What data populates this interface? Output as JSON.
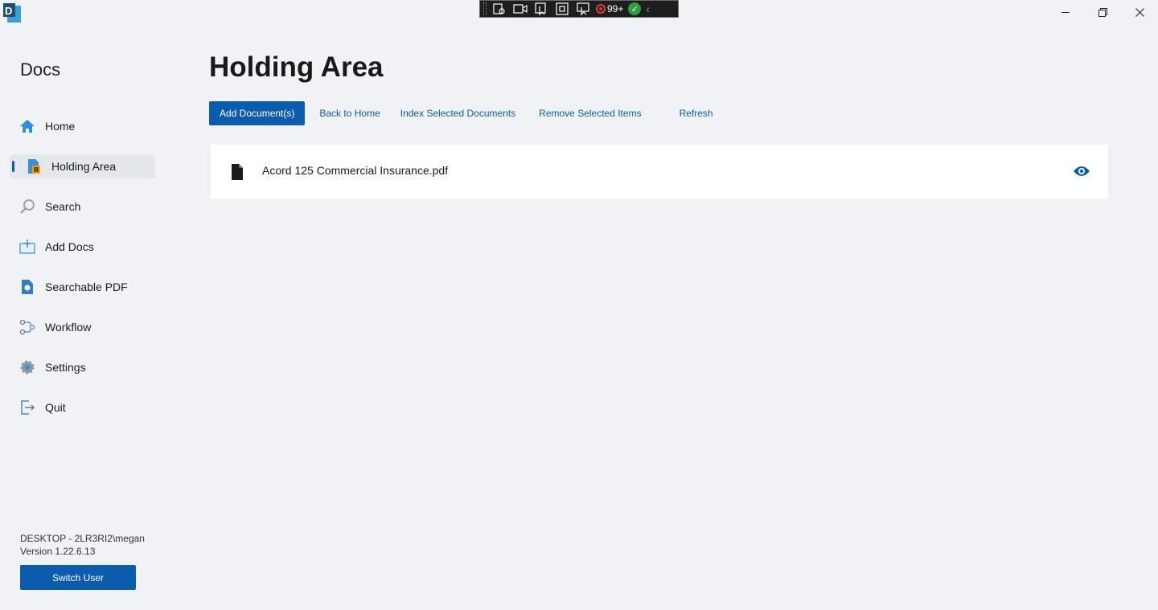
{
  "app": {
    "icon_name": "docs-app-icon",
    "window_controls": [
      "minimize",
      "restore",
      "close"
    ]
  },
  "recorder_toolbar": {
    "count": "99+",
    "icons": [
      "grip-icon",
      "screen-settings-icon",
      "camera-icon",
      "pointer-icon",
      "region-icon",
      "capture-icon",
      "record-icon",
      "check-icon",
      "chevron-left-icon"
    ]
  },
  "sidebar": {
    "title": "Docs",
    "items": [
      {
        "label": "Home",
        "icon": "home-icon",
        "active": false
      },
      {
        "label": "Holding Area",
        "icon": "holding-area-icon",
        "active": true
      },
      {
        "label": "Search",
        "icon": "search-icon",
        "active": false
      },
      {
        "label": "Add Docs",
        "icon": "add-docs-icon",
        "active": false
      },
      {
        "label": "Searchable PDF",
        "icon": "searchable-pdf-icon",
        "active": false
      },
      {
        "label": "Workflow",
        "icon": "workflow-icon",
        "active": false
      },
      {
        "label": "Settings",
        "icon": "gear-icon",
        "active": false
      },
      {
        "label": "Quit",
        "icon": "quit-icon",
        "active": false
      }
    ],
    "user": "DESKTOP - 2LR3RI2\\megan",
    "version": "Version 1.22.6.13",
    "switch_user_label": "Switch User"
  },
  "main": {
    "title": "Holding Area",
    "toolbar": {
      "add_label": "Add Document(s)",
      "back_label": "Back to Home",
      "index_label": "Index Selected Documents",
      "remove_label": "Remove Selected Items",
      "refresh_label": "Refresh"
    },
    "documents": [
      {
        "name": "Acord 125 Commercial Insurance.pdf"
      }
    ]
  },
  "colors": {
    "accent": "#0b5cad",
    "background": "#f0f2f6",
    "card": "#ffffff"
  }
}
